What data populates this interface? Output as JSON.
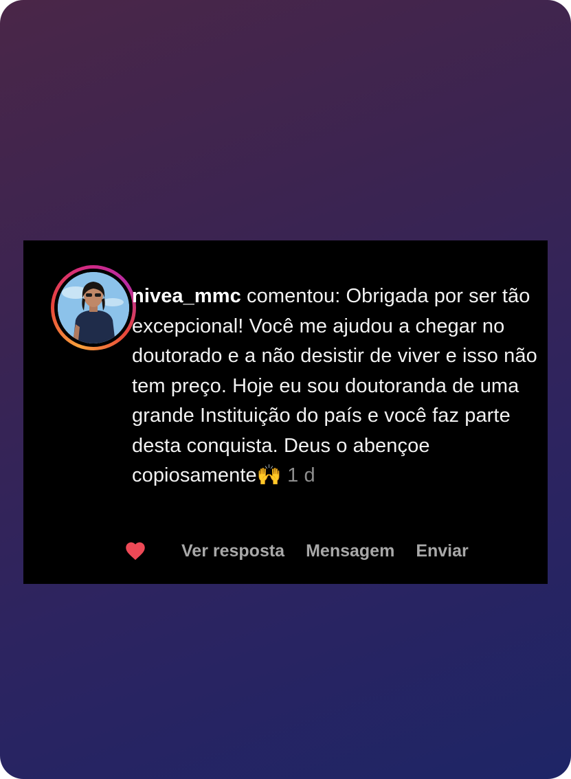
{
  "comment": {
    "username": "nivea_mmc",
    "text": " comentou: Obrigada por ser tão excepcional! Você me ajudou a chegar no doutorado e a não desistir de viver e isso não tem preço. Hoje eu sou doutoranda de uma grande Instituição do país e você faz parte desta conquista. Deus o abençoe copiosamente",
    "emoji": "🙌",
    "time": "1 d"
  },
  "actions": {
    "like_icon": "heart-icon",
    "like_color": "#ed4956",
    "reply_label": "Ver resposta",
    "message_label": "Mensagem",
    "send_label": "Enviar"
  },
  "colors": {
    "card_background": "#000000",
    "text": "#f2f2f2",
    "muted": "#a8a8a8"
  }
}
